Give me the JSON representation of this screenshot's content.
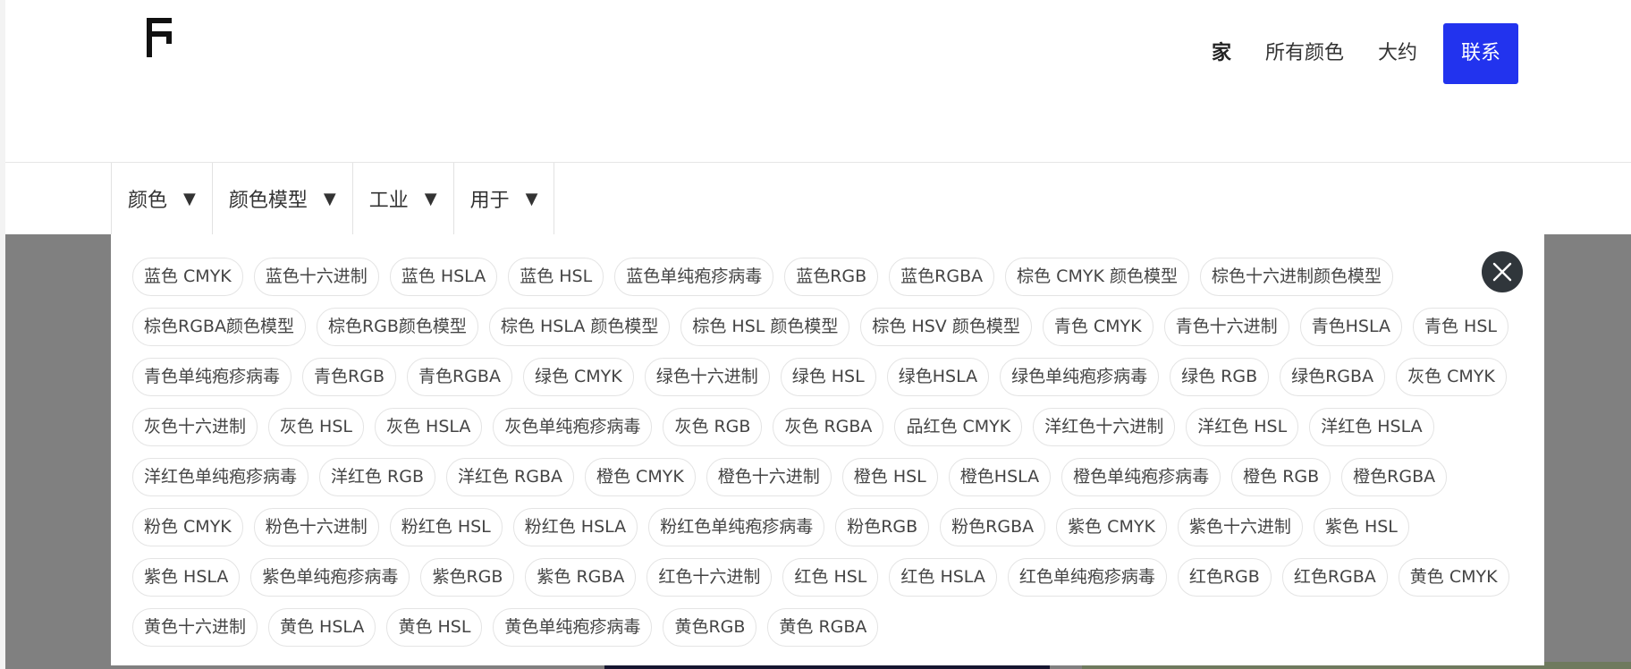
{
  "nav": {
    "items": [
      {
        "label": "家",
        "active": true
      },
      {
        "label": "所有颜色",
        "active": false
      },
      {
        "label": "大约",
        "active": false
      }
    ],
    "contact_label": "联系",
    "contact_color": "#2233ee"
  },
  "filters": [
    {
      "label": "颜色",
      "caret": "▼"
    },
    {
      "label": "颜色模型",
      "caret": "▼"
    },
    {
      "label": "工业",
      "caret": "▼"
    },
    {
      "label": "用于",
      "caret": "▼"
    }
  ],
  "dropdown": {
    "close_icon": "close-icon",
    "tags": [
      "蓝色 CMYK",
      "蓝色十六进制",
      "蓝色 HSLA",
      "蓝色 HSL",
      "蓝色单纯疱疹病毒",
      "蓝色RGB",
      "蓝色RGBA",
      "棕色 CMYK 颜色模型",
      "棕色十六进制颜色模型",
      "棕色RGBA颜色模型",
      "棕色RGB颜色模型",
      "棕色 HSLA 颜色模型",
      "棕色 HSL 颜色模型",
      "棕色 HSV 颜色模型",
      "青色 CMYK",
      "青色十六进制",
      "青色HSLA",
      "青色 HSL",
      "青色单纯疱疹病毒",
      "青色RGB",
      "青色RGBA",
      "绿色 CMYK",
      "绿色十六进制",
      "绿色 HSL",
      "绿色HSLA",
      "绿色单纯疱疹病毒",
      "绿色 RGB",
      "绿色RGBA",
      "灰色 CMYK",
      "灰色十六进制",
      "灰色 HSL",
      "灰色 HSLA",
      "灰色单纯疱疹病毒",
      "灰色 RGB",
      "灰色 RGBA",
      "品红色 CMYK",
      "洋红色十六进制",
      "洋红色 HSL",
      "洋红色 HSLA",
      "洋红色单纯疱疹病毒",
      "洋红色 RGB",
      "洋红色 RGBA",
      "橙色 CMYK",
      "橙色十六进制",
      "橙色 HSL",
      "橙色HSLA",
      "橙色单纯疱疹病毒",
      "橙色 RGB",
      "橙色RGBA",
      "粉色 CMYK",
      "粉色十六进制",
      "粉红色 HSL",
      "粉红色 HSLA",
      "粉红色单纯疱疹病毒",
      "粉色RGB",
      "粉色RGBA",
      "紫色 CMYK",
      "紫色十六进制",
      "紫色 HSL",
      "紫色 HSLA",
      "紫色单纯疱疹病毒",
      "紫色RGB",
      "紫色 RGBA",
      "红色十六进制",
      "红色 HSL",
      "红色 HSLA",
      "红色单纯疱疹病毒",
      "红色RGB",
      "红色RGBA",
      "黄色 CMYK",
      "黄色十六进制",
      "黄色 HSLA",
      "黄色 HSL",
      "黄色单纯疱疹病毒",
      "黄色RGB",
      "黄色 RGBA"
    ]
  }
}
